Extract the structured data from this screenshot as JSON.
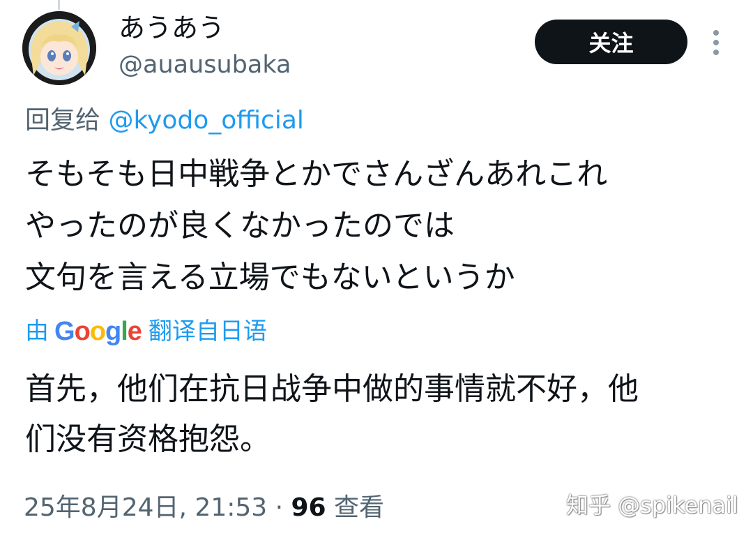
{
  "author": {
    "display_name": "あうあう",
    "handle": "@auausubaka"
  },
  "follow_button_label": "关注",
  "more_icon": "more-vertical-icon",
  "reply_to": {
    "prefix": "回复给 ",
    "mention": "@kyodo_official"
  },
  "tweet": {
    "lines": [
      "そもそも日中戦争とかでさんざんあれこれ",
      "やったのが良くなかったのでは",
      "文句を言える立場でもないというか"
    ]
  },
  "translation": {
    "prefix": "由",
    "provider": "Google",
    "suffix": "翻译自日语",
    "lines": [
      "首先，他们在抗日战争中做的事情就不好，他",
      "们没有资格抱怨。"
    ]
  },
  "meta": {
    "timestamp": "25年8月24日, 21:53 · ",
    "views_count": "96",
    "views_label": " 查看"
  },
  "watermark": "知乎 @spikenail",
  "colors": {
    "link": "#1d9bf0",
    "secondary_text": "#536471",
    "follow_button_bg": "#0f1419"
  }
}
